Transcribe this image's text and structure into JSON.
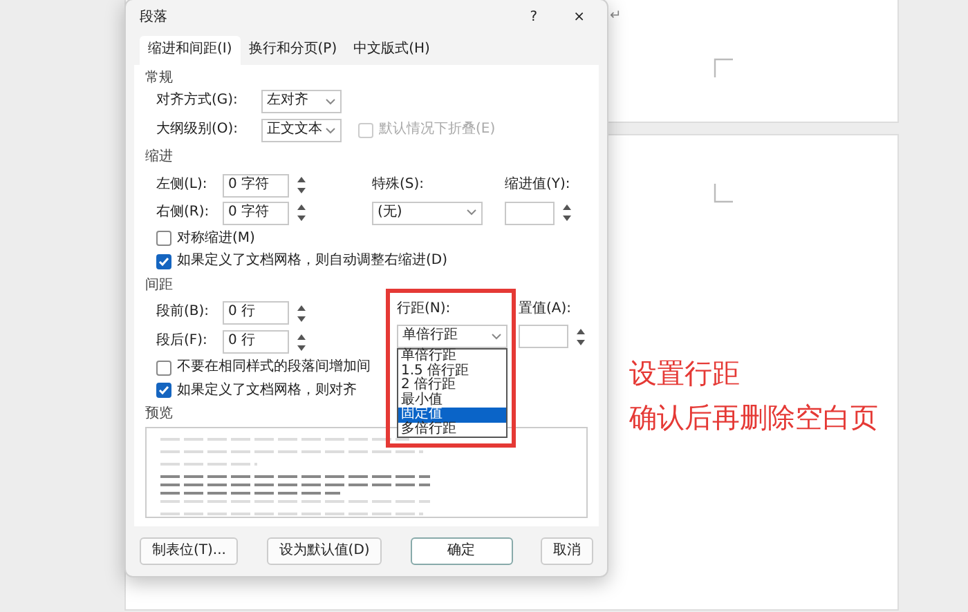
{
  "document": {
    "paragraph_mark": "↵"
  },
  "dialog": {
    "title": "段落",
    "help": "?",
    "close": "×",
    "tabs": [
      {
        "label": "缩进和间距(I)",
        "selected": true
      },
      {
        "label": "换行和分页(P)",
        "selected": false
      },
      {
        "label": "中文版式(H)",
        "selected": false
      }
    ],
    "general": {
      "heading": "常规",
      "alignment": {
        "label": "对齐方式(G):",
        "value": "左对齐"
      },
      "outline": {
        "label": "大纲级别(O):",
        "value": "正文文本"
      },
      "collapse": {
        "label": "默认情况下折叠(E)",
        "checked": false,
        "disabled": true
      }
    },
    "indent": {
      "heading": "缩进",
      "left": {
        "label": "左侧(L):",
        "value": "0 字符"
      },
      "right": {
        "label": "右侧(R):",
        "value": "0 字符"
      },
      "special": {
        "label": "特殊(S):",
        "value": "(无)"
      },
      "by": {
        "label": "缩进值(Y):"
      },
      "mirror": {
        "label": "对称缩进(M)",
        "checked": false
      },
      "auto_adjust": {
        "label": "如果定义了文档网格，则自动调整右缩进(D)",
        "checked": true
      }
    },
    "spacing": {
      "heading": "间距",
      "before": {
        "label": "段前(B):",
        "value": "0 行"
      },
      "after": {
        "label": "段后(F):",
        "value": "0 行"
      },
      "line": {
        "label": "行距(N):",
        "value": "单倍行距"
      },
      "at": {
        "label": "置值(A):"
      },
      "no_space": {
        "label": "不要在相同样式的段落间增加间",
        "checked": false
      },
      "snap": {
        "label": "如果定义了文档网格，则对齐",
        "checked": true
      }
    },
    "line_options": [
      {
        "label": "单倍行距",
        "selected": false
      },
      {
        "label": "1.5 倍行距",
        "selected": false
      },
      {
        "label": "2 倍行距",
        "selected": false
      },
      {
        "label": "最小值",
        "selected": false
      },
      {
        "label": "固定值",
        "selected": true
      },
      {
        "label": "多倍行距",
        "selected": false
      }
    ],
    "preview": {
      "heading": "预览"
    },
    "buttons": [
      {
        "label": "制表位(T)...",
        "kind": "default"
      },
      {
        "label": "设为默认值(D)",
        "kind": "default"
      },
      {
        "label": "确定",
        "kind": "primary"
      },
      {
        "label": "取消",
        "kind": "default"
      }
    ]
  },
  "annotation": {
    "lines": [
      "设置行距",
      "确认后再删除空白页"
    ]
  }
}
